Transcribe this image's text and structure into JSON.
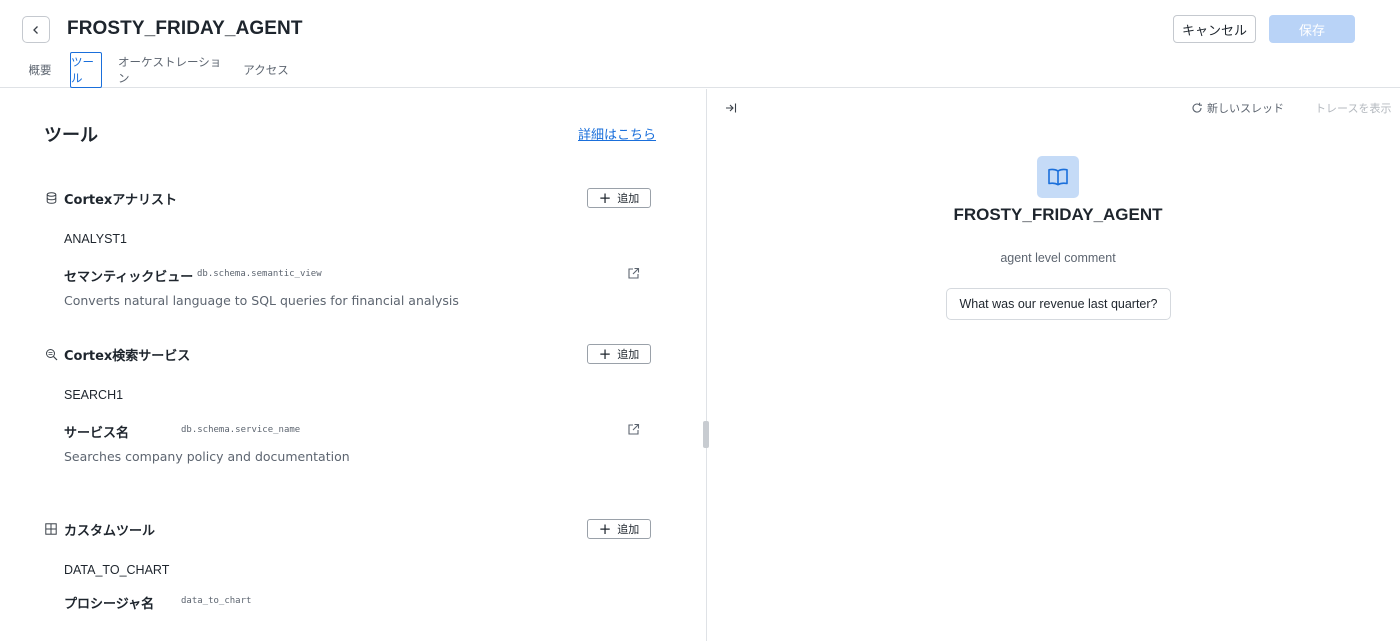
{
  "header": {
    "title": "FROSTY_FRIDAY_AGENT",
    "cancel_label": "キャンセル",
    "save_label": "保存"
  },
  "tabs": [
    {
      "label": "概要",
      "active": false
    },
    {
      "label": "ツール",
      "active": true
    },
    {
      "label": "オーケストレーション",
      "active": false
    },
    {
      "label": "アクセス",
      "active": false
    }
  ],
  "tools_panel": {
    "title": "ツール",
    "learn_more_label": "詳細はこちら",
    "add_label": "追加",
    "sections": [
      {
        "title": "Cortexアナリスト",
        "icon": "database-icon",
        "item_name": "ANALYST1",
        "prop_label": "セマンティックビュー",
        "prop_value": "db.schema.semantic_view",
        "description": "Converts natural language to SQL queries for financial analysis"
      },
      {
        "title": "Cortex検索サービス",
        "icon": "search-service-icon",
        "item_name": "SEARCH1",
        "prop_label": "サービス名",
        "prop_value": "db.schema.service_name",
        "description": "Searches company policy and documentation"
      },
      {
        "title": "カスタムツール",
        "icon": "custom-tool-icon",
        "item_name": "DATA_TO_CHART",
        "prop_label": "プロシージャ名",
        "prop_value": "data_to_chart"
      }
    ]
  },
  "chat_panel": {
    "new_thread_label": "新しいスレッド",
    "show_trace_label": "トレースを表示",
    "agent_name": "FROSTY_FRIDAY_AGENT",
    "agent_comment": "agent level comment",
    "suggestion": "What was our revenue last quarter?"
  },
  "colors": {
    "accent": "#1a6fdb",
    "save_disabled": "#b9d3f7",
    "avatar_bg": "#c5dbf7"
  }
}
